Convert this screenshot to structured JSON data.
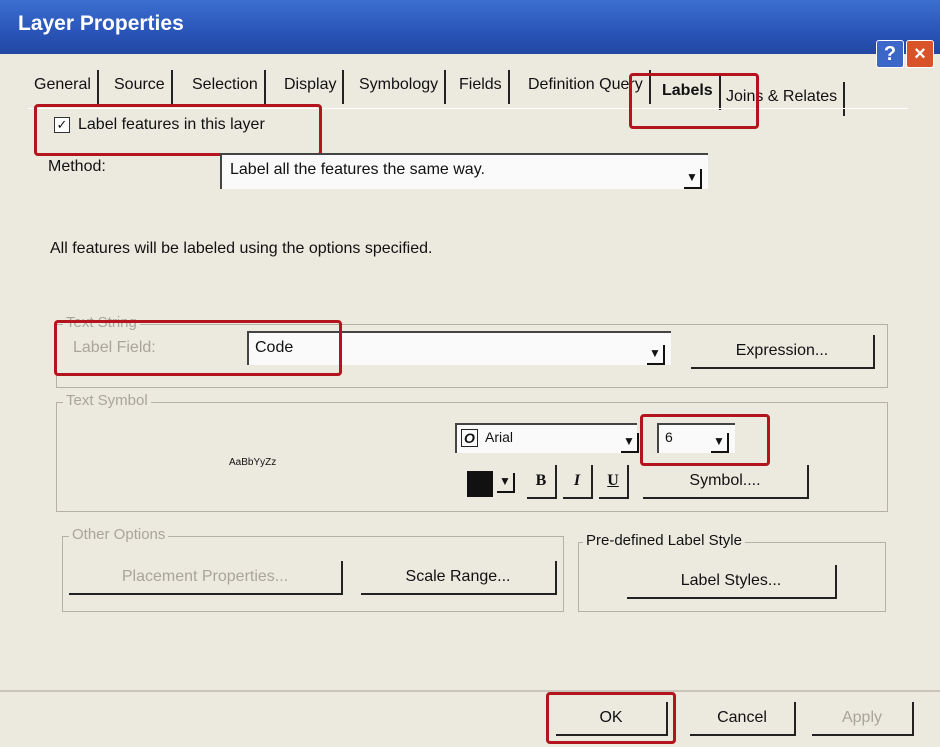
{
  "window": {
    "title": "Layer Properties",
    "help_icon": "?",
    "close_icon": "×"
  },
  "tabs": [
    {
      "label": "General"
    },
    {
      "label": "Source"
    },
    {
      "label": "Selection"
    },
    {
      "label": "Display"
    },
    {
      "label": "Symbology"
    },
    {
      "label": "Fields"
    },
    {
      "label": "Definition Query"
    },
    {
      "label": "Labels",
      "selected": true
    },
    {
      "label": "Joins & Relates"
    }
  ],
  "labels_tab": {
    "label_features_checkbox": {
      "label": "Label features in this layer",
      "checked": true,
      "check_mark": "✓"
    },
    "method": {
      "label": "Method:",
      "value": "Label all the features the same way."
    },
    "info_text": "All features will be labeled using the options specified.",
    "text_string": {
      "group_title": "Text String",
      "label_field_label": "Label Field:",
      "label_field_value": "Code",
      "expression_button": "Expression..."
    },
    "text_symbol": {
      "group_title": "Text Symbol",
      "preview": "AaBbYyZz",
      "font_value": "Arial",
      "font_icon": "O",
      "size_value": "6",
      "bold_label": "B",
      "italic_label": "I",
      "underline_label": "U",
      "symbol_button": "Symbol...."
    },
    "other_options": {
      "group_title": "Other Options",
      "placement_button": "Placement Properties...",
      "scale_button": "Scale Range..."
    },
    "predefined_style": {
      "group_title": "Pre-defined Label Style",
      "label_styles_button": "Label Styles..."
    }
  },
  "footer": {
    "ok": "OK",
    "cancel": "Cancel",
    "apply": "Apply"
  },
  "colors": {
    "annotation_red": "#b3141d",
    "title_bar_blue": "#2a54b8"
  },
  "dropdown_arrow_icon": "▼"
}
